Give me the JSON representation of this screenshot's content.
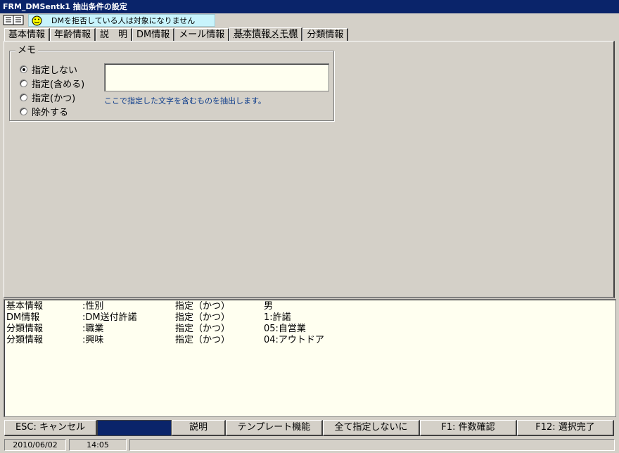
{
  "window": {
    "title": "FRM_DMSentk1 抽出条件の設定"
  },
  "message": {
    "text": "DMを拒否している人は対象になりません"
  },
  "tabs": [
    {
      "label": "基本情報"
    },
    {
      "label": "年齢情報"
    },
    {
      "label": "説　明"
    },
    {
      "label": "DM情報"
    },
    {
      "label": "メール情報"
    },
    {
      "label": "基本情報メモ欄"
    },
    {
      "label": "分類情報"
    }
  ],
  "memo_group": {
    "title": "メモ",
    "options": [
      {
        "label": "指定しない",
        "checked": true
      },
      {
        "label": "指定(含める)",
        "checked": false
      },
      {
        "label": "指定(かつ)",
        "checked": false
      },
      {
        "label": "除外する",
        "checked": false
      }
    ],
    "input_value": "",
    "hint": "ここで指定した文字を含むものを抽出します。"
  },
  "summary": {
    "rows": [
      {
        "category": "基本情報",
        "field": ":性別",
        "mode": "指定（かつ）",
        "value": "男"
      },
      {
        "category": "DM情報",
        "field": ":DM送付許諾",
        "mode": "指定（かつ）",
        "value": "1:許諾"
      },
      {
        "category": "分類情報",
        "field": ":職業",
        "mode": "指定（かつ）",
        "value": "05:自営業"
      },
      {
        "category": "分類情報",
        "field": ":興味",
        "mode": "指定（かつ）",
        "value": "04:アウトドア"
      }
    ]
  },
  "buttons": {
    "escape": "ESC: キャンセル",
    "explain": "説明",
    "template": "テンプレート機能",
    "clear_all": "全て指定しないに",
    "count": "F1: 件数確認",
    "done": "F12: 選択完了"
  },
  "status": {
    "date": "2010/06/02",
    "time": "14:05"
  },
  "colors": {
    "titlebar": "#0a246a",
    "message_bg": "#c8f4fc",
    "input_bg": "#fffff0",
    "hint_text": "#0a3a8a"
  }
}
